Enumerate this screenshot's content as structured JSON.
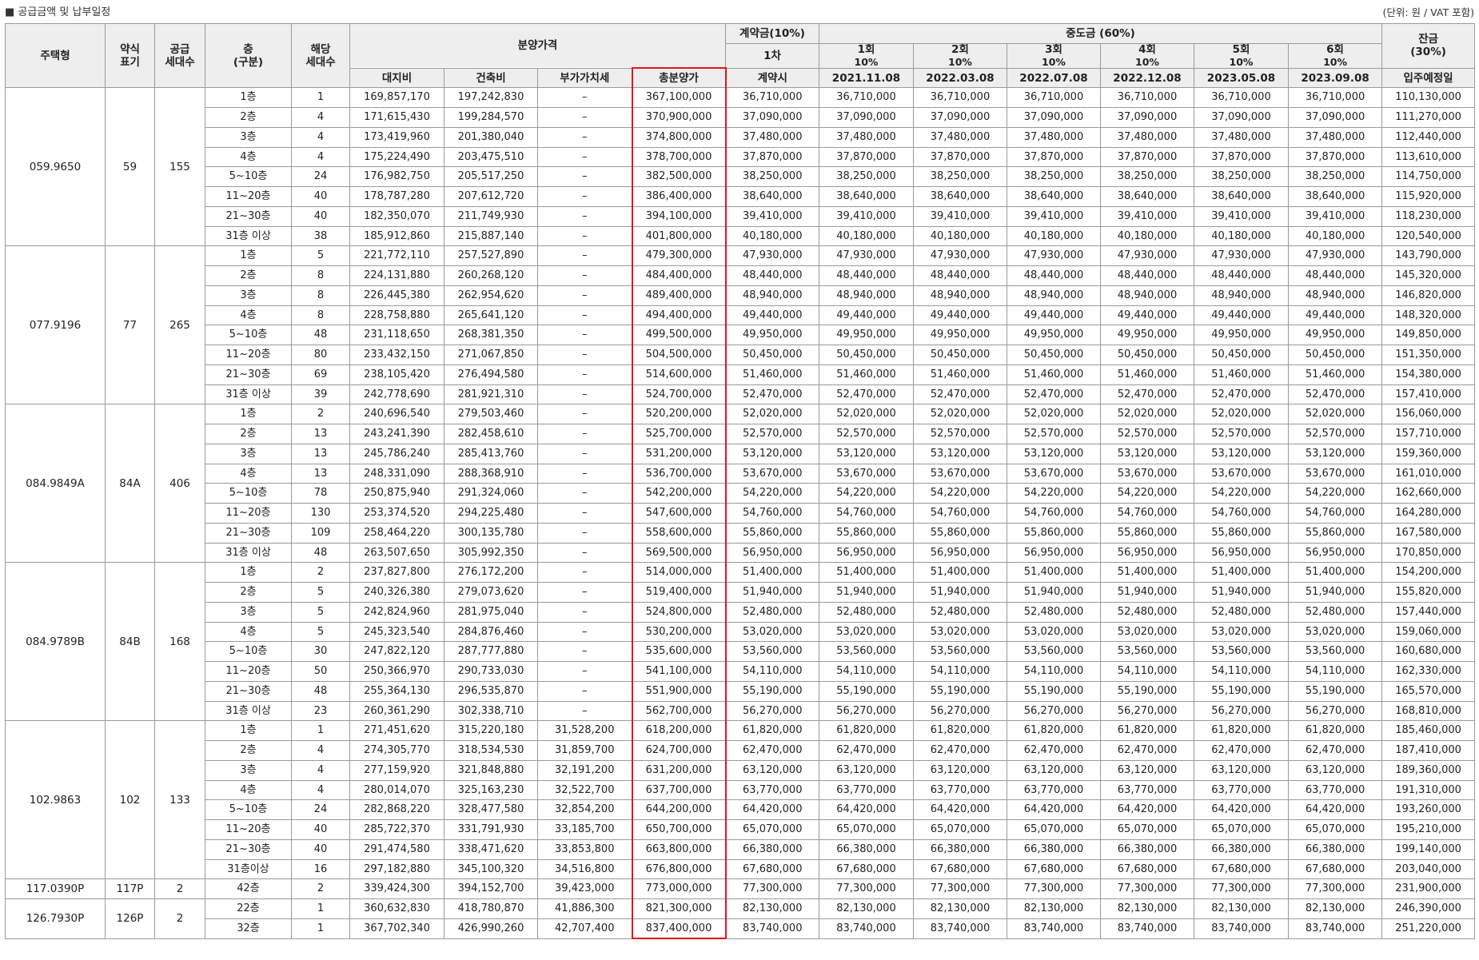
{
  "page": {
    "title": "■ 공급금액 및 납부일정",
    "unit": "(단위: 원 / VAT 포함)"
  },
  "headers": {
    "house_type": "주택형",
    "abbr": [
      "약식",
      "표기"
    ],
    "supply_units": [
      "공급",
      "세대수"
    ],
    "floor": [
      "층",
      "(구분)"
    ],
    "units": [
      "해당",
      "세대수"
    ],
    "sale_price": "분양가격",
    "land": "대지비",
    "building": "건축비",
    "vat": "부가가치세",
    "total": "총분양가",
    "deposit": "계약금(10%)",
    "deposit_round": "1차",
    "deposit_time": "계약시",
    "middle": "중도금 (60%)",
    "rounds": [
      "1회",
      "2회",
      "3회",
      "4회",
      "5회",
      "6회"
    ],
    "round_pct": "10%",
    "dates": [
      "2021.11.08",
      "2022.03.08",
      "2022.07.08",
      "2022.12.08",
      "2023.05.08",
      "2023.09.08"
    ],
    "balance": [
      "잔금",
      "(30%)"
    ],
    "balance_time": "입주예정일"
  },
  "groups": [
    {
      "type": "059.9650",
      "abbr": "59",
      "supply": "155",
      "rows": [
        [
          "1층",
          "1",
          "169,857,170",
          "197,242,830",
          "–",
          "367,100,000",
          "36,710,000",
          "36,710,000",
          "110,130,000"
        ],
        [
          "2층",
          "4",
          "171,615,430",
          "199,284,570",
          "–",
          "370,900,000",
          "37,090,000",
          "37,090,000",
          "111,270,000"
        ],
        [
          "3층",
          "4",
          "173,419,960",
          "201,380,040",
          "–",
          "374,800,000",
          "37,480,000",
          "37,480,000",
          "112,440,000"
        ],
        [
          "4층",
          "4",
          "175,224,490",
          "203,475,510",
          "–",
          "378,700,000",
          "37,870,000",
          "37,870,000",
          "113,610,000"
        ],
        [
          "5~10층",
          "24",
          "176,982,750",
          "205,517,250",
          "–",
          "382,500,000",
          "38,250,000",
          "38,250,000",
          "114,750,000"
        ],
        [
          "11~20층",
          "40",
          "178,787,280",
          "207,612,720",
          "–",
          "386,400,000",
          "38,640,000",
          "38,640,000",
          "115,920,000"
        ],
        [
          "21~30층",
          "40",
          "182,350,070",
          "211,749,930",
          "–",
          "394,100,000",
          "39,410,000",
          "39,410,000",
          "118,230,000"
        ],
        [
          "31층 이상",
          "38",
          "185,912,860",
          "215,887,140",
          "–",
          "401,800,000",
          "40,180,000",
          "40,180,000",
          "120,540,000"
        ]
      ]
    },
    {
      "type": "077.9196",
      "abbr": "77",
      "supply": "265",
      "rows": [
        [
          "1층",
          "5",
          "221,772,110",
          "257,527,890",
          "–",
          "479,300,000",
          "47,930,000",
          "47,930,000",
          "143,790,000"
        ],
        [
          "2층",
          "8",
          "224,131,880",
          "260,268,120",
          "–",
          "484,400,000",
          "48,440,000",
          "48,440,000",
          "145,320,000"
        ],
        [
          "3층",
          "8",
          "226,445,380",
          "262,954,620",
          "–",
          "489,400,000",
          "48,940,000",
          "48,940,000",
          "146,820,000"
        ],
        [
          "4층",
          "8",
          "228,758,880",
          "265,641,120",
          "–",
          "494,400,000",
          "49,440,000",
          "49,440,000",
          "148,320,000"
        ],
        [
          "5~10층",
          "48",
          "231,118,650",
          "268,381,350",
          "–",
          "499,500,000",
          "49,950,000",
          "49,950,000",
          "149,850,000"
        ],
        [
          "11~20층",
          "80",
          "233,432,150",
          "271,067,850",
          "–",
          "504,500,000",
          "50,450,000",
          "50,450,000",
          "151,350,000"
        ],
        [
          "21~30층",
          "69",
          "238,105,420",
          "276,494,580",
          "–",
          "514,600,000",
          "51,460,000",
          "51,460,000",
          "154,380,000"
        ],
        [
          "31층 이상",
          "39",
          "242,778,690",
          "281,921,310",
          "–",
          "524,700,000",
          "52,470,000",
          "52,470,000",
          "157,410,000"
        ]
      ]
    },
    {
      "type": "084.9849A",
      "abbr": "84A",
      "supply": "406",
      "rows": [
        [
          "1층",
          "2",
          "240,696,540",
          "279,503,460",
          "–",
          "520,200,000",
          "52,020,000",
          "52,020,000",
          "156,060,000"
        ],
        [
          "2층",
          "13",
          "243,241,390",
          "282,458,610",
          "–",
          "525,700,000",
          "52,570,000",
          "52,570,000",
          "157,710,000"
        ],
        [
          "3층",
          "13",
          "245,786,240",
          "285,413,760",
          "–",
          "531,200,000",
          "53,120,000",
          "53,120,000",
          "159,360,000"
        ],
        [
          "4층",
          "13",
          "248,331,090",
          "288,368,910",
          "–",
          "536,700,000",
          "53,670,000",
          "53,670,000",
          "161,010,000"
        ],
        [
          "5~10층",
          "78",
          "250,875,940",
          "291,324,060",
          "–",
          "542,200,000",
          "54,220,000",
          "54,220,000",
          "162,660,000"
        ],
        [
          "11~20층",
          "130",
          "253,374,520",
          "294,225,480",
          "–",
          "547,600,000",
          "54,760,000",
          "54,760,000",
          "164,280,000"
        ],
        [
          "21~30층",
          "109",
          "258,464,220",
          "300,135,780",
          "–",
          "558,600,000",
          "55,860,000",
          "55,860,000",
          "167,580,000"
        ],
        [
          "31층 이상",
          "48",
          "263,507,650",
          "305,992,350",
          "–",
          "569,500,000",
          "56,950,000",
          "56,950,000",
          "170,850,000"
        ]
      ]
    },
    {
      "type": "084.9789B",
      "abbr": "84B",
      "supply": "168",
      "rows": [
        [
          "1층",
          "2",
          "237,827,800",
          "276,172,200",
          "–",
          "514,000,000",
          "51,400,000",
          "51,400,000",
          "154,200,000"
        ],
        [
          "2층",
          "5",
          "240,326,380",
          "279,073,620",
          "–",
          "519,400,000",
          "51,940,000",
          "51,940,000",
          "155,820,000"
        ],
        [
          "3층",
          "5",
          "242,824,960",
          "281,975,040",
          "–",
          "524,800,000",
          "52,480,000",
          "52,480,000",
          "157,440,000"
        ],
        [
          "4층",
          "5",
          "245,323,540",
          "284,876,460",
          "–",
          "530,200,000",
          "53,020,000",
          "53,020,000",
          "159,060,000"
        ],
        [
          "5~10층",
          "30",
          "247,822,120",
          "287,777,880",
          "–",
          "535,600,000",
          "53,560,000",
          "53,560,000",
          "160,680,000"
        ],
        [
          "11~20층",
          "50",
          "250,366,970",
          "290,733,030",
          "–",
          "541,100,000",
          "54,110,000",
          "54,110,000",
          "162,330,000"
        ],
        [
          "21~30층",
          "48",
          "255,364,130",
          "296,535,870",
          "–",
          "551,900,000",
          "55,190,000",
          "55,190,000",
          "165,570,000"
        ],
        [
          "31층 이상",
          "23",
          "260,361,290",
          "302,338,710",
          "–",
          "562,700,000",
          "56,270,000",
          "56,270,000",
          "168,810,000"
        ]
      ]
    },
    {
      "type": "102.9863",
      "abbr": "102",
      "supply": "133",
      "rows": [
        [
          "1층",
          "1",
          "271,451,620",
          "315,220,180",
          "31,528,200",
          "618,200,000",
          "61,820,000",
          "61,820,000",
          "185,460,000"
        ],
        [
          "2층",
          "4",
          "274,305,770",
          "318,534,530",
          "31,859,700",
          "624,700,000",
          "62,470,000",
          "62,470,000",
          "187,410,000"
        ],
        [
          "3층",
          "4",
          "277,159,920",
          "321,848,880",
          "32,191,200",
          "631,200,000",
          "63,120,000",
          "63,120,000",
          "189,360,000"
        ],
        [
          "4층",
          "4",
          "280,014,070",
          "325,163,230",
          "32,522,700",
          "637,700,000",
          "63,770,000",
          "63,770,000",
          "191,310,000"
        ],
        [
          "5~10층",
          "24",
          "282,868,220",
          "328,477,580",
          "32,854,200",
          "644,200,000",
          "64,420,000",
          "64,420,000",
          "193,260,000"
        ],
        [
          "11~20층",
          "40",
          "285,722,370",
          "331,791,930",
          "33,185,700",
          "650,700,000",
          "65,070,000",
          "65,070,000",
          "195,210,000"
        ],
        [
          "21~30층",
          "40",
          "291,474,580",
          "338,471,620",
          "33,853,800",
          "663,800,000",
          "66,380,000",
          "66,380,000",
          "199,140,000"
        ],
        [
          "31층이상",
          "16",
          "297,182,880",
          "345,100,320",
          "34,516,800",
          "676,800,000",
          "67,680,000",
          "67,680,000",
          "203,040,000"
        ]
      ]
    },
    {
      "type": "117.0390P",
      "abbr": "117P",
      "supply": "2",
      "rows": [
        [
          "42층",
          "2",
          "339,424,300",
          "394,152,700",
          "39,423,000",
          "773,000,000",
          "77,300,000",
          "77,300,000",
          "231,900,000"
        ]
      ]
    },
    {
      "type": "126.7930P",
      "abbr": "126P",
      "supply": "2",
      "rows": [
        [
          "22층",
          "1",
          "360,632,830",
          "418,780,870",
          "41,886,300",
          "821,300,000",
          "82,130,000",
          "82,130,000",
          "246,390,000"
        ],
        [
          "32층",
          "1",
          "367,702,340",
          "426,990,260",
          "42,707,400",
          "837,400,000",
          "83,740,000",
          "83,740,000",
          "251,220,000"
        ]
      ]
    }
  ]
}
